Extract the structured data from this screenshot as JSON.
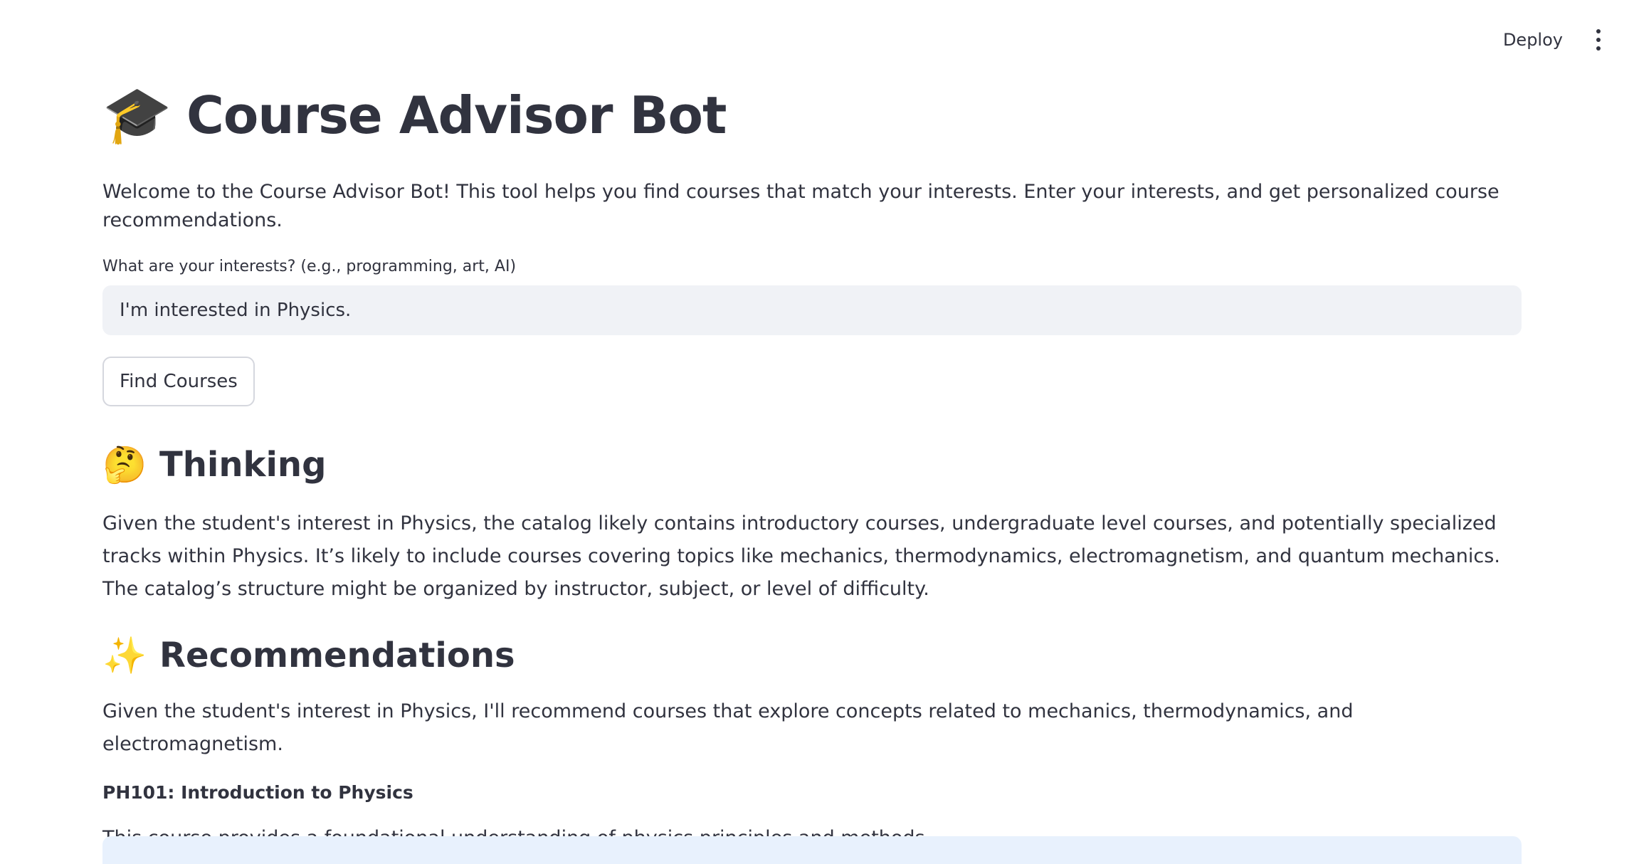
{
  "header": {
    "deploy_label": "Deploy",
    "menu_icon": "vertical-ellipsis-icon"
  },
  "main": {
    "title_icon": "🎓",
    "title": "Course Advisor Bot",
    "intro": "Welcome to the Course Advisor Bot! This tool helps you find courses that match your interests. Enter your interests, and get personalized course recommendations.",
    "input_label": "What are your interests? (e.g., programming, art, AI)",
    "input_value": "I'm interested in Physics.",
    "button_label": "Find Courses"
  },
  "thinking": {
    "icon": "🤔",
    "heading": "Thinking",
    "text": "Given the student's interest in Physics, the catalog likely contains introductory courses, undergraduate level courses, and potentially specialized tracks within Physics. It’s likely to include courses covering topics like mechanics, thermodynamics, electromagnetism, and quantum mechanics. The catalog’s structure might be organized by instructor, subject, or level of difficulty."
  },
  "recommendations": {
    "icon": "✨",
    "heading": "Recommendations",
    "intro": "Given the student's interest in Physics, I'll recommend courses that explore concepts related to mechanics, thermodynamics, and electromagnetism.",
    "course_title": "PH101: Introduction to Physics",
    "course_description": "This course provides a foundational understanding of physics principles and methods."
  },
  "colors": {
    "text": "#31333f",
    "input_bg": "#f0f2f6",
    "info_bg": "#e8f1fd"
  }
}
